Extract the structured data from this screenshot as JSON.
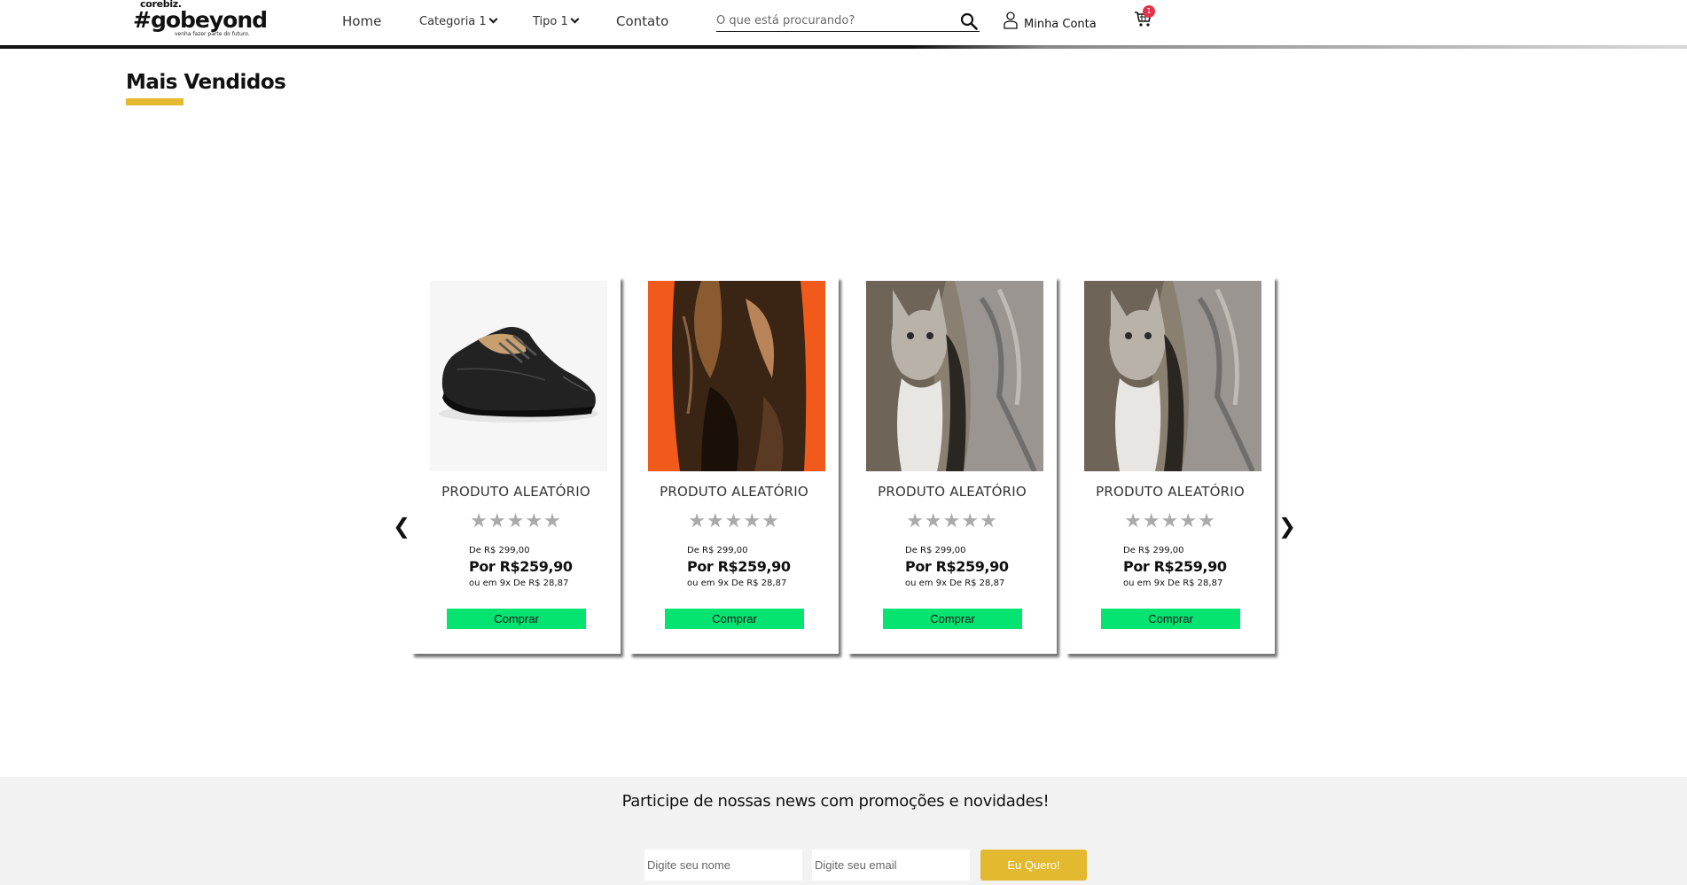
{
  "header": {
    "logo": {
      "brand": "corebiz.",
      "name": "#gobeyond",
      "tagline": "venha fazer parte do futuro."
    },
    "nav": {
      "home": "Home",
      "category": "Categoria 1",
      "type": "Tipo 1",
      "contact": "Contato"
    },
    "search": {
      "placeholder": "O que está procurando?"
    },
    "account_label": "Minha Conta",
    "cart_count": "1"
  },
  "section": {
    "title": "Mais Vendidos"
  },
  "carousel": {
    "prev_label": "❮",
    "next_label": "❯",
    "products": [
      {
        "image": "black-leather-shoe",
        "name": "PRODUTO ALEATÓRIO",
        "stars": "★★★★★",
        "rating": 0,
        "old_price": "De R$ 299,00",
        "price": "Por R$259,90",
        "installments": "ou em 9x De R$ 28,87",
        "button": "Comprar"
      },
      {
        "image": "fox-fur-on-orange",
        "name": "PRODUTO ALEATÓRIO",
        "stars": "★★★★★",
        "rating": 0,
        "old_price": "De R$ 299,00",
        "price": "Por R$259,90",
        "installments": "ou em 9x De R$ 28,87",
        "button": "Comprar"
      },
      {
        "image": "tabby-kitten",
        "name": "PRODUTO ALEATÓRIO",
        "stars": "★★★★★",
        "rating": 0,
        "old_price": "De R$ 299,00",
        "price": "Por R$259,90",
        "installments": "ou em 9x De R$ 28,87",
        "button": "Comprar"
      },
      {
        "image": "tabby-kitten",
        "name": "PRODUTO ALEATÓRIO",
        "stars": "★★★★★",
        "rating": 0,
        "old_price": "De R$ 299,00",
        "price": "Por R$259,90",
        "installments": "ou em 9x De R$ 28,87",
        "button": "Comprar"
      }
    ]
  },
  "newsletter": {
    "title": "Participe de nossas news com promoções e novidades!",
    "name_placeholder": "Digite seu nome",
    "email_placeholder": "Digite seu email",
    "button": "Eu Quero!"
  },
  "colors": {
    "accent_yellow": "#e3b92f",
    "buy_button_green": "#05e371",
    "cart_badge_red": "#e2334b",
    "star_gray": "#aaaaaa"
  }
}
